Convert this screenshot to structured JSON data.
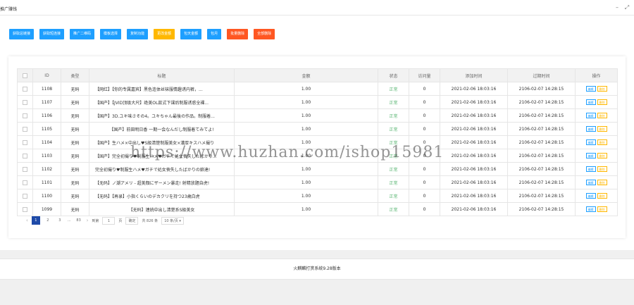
{
  "window": {
    "title": "推广赚钱"
  },
  "toolbar": {
    "buttons": [
      {
        "label": "获取总链接",
        "color": "blue"
      },
      {
        "label": "获取短连接",
        "color": "blue"
      },
      {
        "label": "推广二维码",
        "color": "blue"
      },
      {
        "label": "模板选择",
        "color": "blue"
      },
      {
        "label": "复制功能",
        "color": "blue"
      },
      {
        "label": "更改金额",
        "color": "orange"
      },
      {
        "label": "包天金额",
        "color": "blue"
      },
      {
        "label": "包月",
        "color": "blue"
      },
      {
        "label": "批量删除",
        "color": "red"
      },
      {
        "label": "全部删除",
        "color": "red"
      }
    ]
  },
  "table": {
    "headers": [
      "ID",
      "类型",
      "标题",
      "金额",
      "状态",
      "访问量",
      "添加时间",
      "过期时间",
      "操作"
    ],
    "edit_label": "编辑",
    "delete_label": "删除",
    "rows": [
      {
        "id": "1108",
        "type": "无码",
        "title": "【网红】【你的专属嘉宾】黑色连体丝袜服情趣诱内裤，...",
        "amount": "1.00",
        "status": "正常",
        "visits": "0",
        "added": "2021-02-06 18:03:16",
        "expires": "2106-02-07 14:28:15"
      },
      {
        "id": "1107",
        "type": "无码",
        "title": "【国产】【JVID顶级大尺】绝美OL款式下课后制服诱惑全裸...",
        "amount": "1.00",
        "status": "正常",
        "visits": "0",
        "added": "2021-02-06 18:03:16",
        "expires": "2106-02-07 14:28:15"
      },
      {
        "id": "1106",
        "type": "无码",
        "title": "【国产】3D.ユキ味さその4。ユキちゃん最後の作品。制服着...",
        "amount": "1.00",
        "status": "正常",
        "visits": "0",
        "added": "2021-02-06 18:03:16",
        "expires": "2106-02-07 14:28:15"
      },
      {
        "id": "1105",
        "type": "无码",
        "title": "【国产】前田明日香 一期一会なんだし制服着てみてよ!",
        "amount": "1.00",
        "status": "正常",
        "visits": "0",
        "added": "2021-02-06 18:03:16",
        "expires": "2106-02-07 14:28:15"
      },
      {
        "id": "1104",
        "type": "无码",
        "title": "【国产】生ハメ×中出し♥S級清楚制服美女×濃厚キスハメ撮り",
        "amount": "1.00",
        "status": "正常",
        "visits": "0",
        "added": "2021-02-06 18:03:16",
        "expires": "2106-02-07 14:28:15"
      },
      {
        "id": "1103",
        "type": "无码",
        "title": "【国产】完全初撮り♥制服生ハメ♥ガチで処女喪失したばかり...",
        "amount": "1.00",
        "status": "正常",
        "visits": "0",
        "added": "2021-02-06 18:03:16",
        "expires": "2106-02-07 14:28:15"
      },
      {
        "id": "1102",
        "type": "无码",
        "title": "完全初撮り♥制服生ハメ♥ガチで処女喪失したばかりの娘達!",
        "amount": "1.00",
        "status": "正常",
        "visits": "0",
        "added": "2021-02-06 18:03:16",
        "expires": "2106-02-07 14:28:15"
      },
      {
        "id": "1101",
        "type": "无码",
        "title": "【无码】ノ潮アメリ - 超美顔にザーメン暴走! 射精放題自虎!",
        "amount": "1.00",
        "status": "正常",
        "visits": "0",
        "added": "2021-02-06 18:03:16",
        "expires": "2106-02-07 14:28:15"
      },
      {
        "id": "1100",
        "type": "无码",
        "title": "【无码】【再录】小指くらいのデカクリを持つ23歳白虎",
        "amount": "1.00",
        "status": "正常",
        "visits": "0",
        "added": "2021-02-06 18:03:16",
        "expires": "2106-02-07 14:28:15"
      },
      {
        "id": "1099",
        "type": "无码",
        "title": "【无码】連続中出し清楚系S級美女",
        "amount": "1.00",
        "status": "正常",
        "visits": "0",
        "added": "2021-02-06 18:03:16",
        "expires": "2106-02-07 14:28:15"
      }
    ]
  },
  "pagination": {
    "prev": "‹",
    "pages": [
      "1",
      "2",
      "3",
      "...",
      "83"
    ],
    "next": "›",
    "goto_label": "到第",
    "goto_value": "1",
    "page_unit": "页",
    "confirm_label": "确定",
    "total": "共 826 条",
    "page_size": "10 条/页"
  },
  "footer": {
    "text": "火麒麟打赏系统9.28版本"
  },
  "watermark": {
    "text": "https://www.huzhan.com/ishop15981"
  }
}
